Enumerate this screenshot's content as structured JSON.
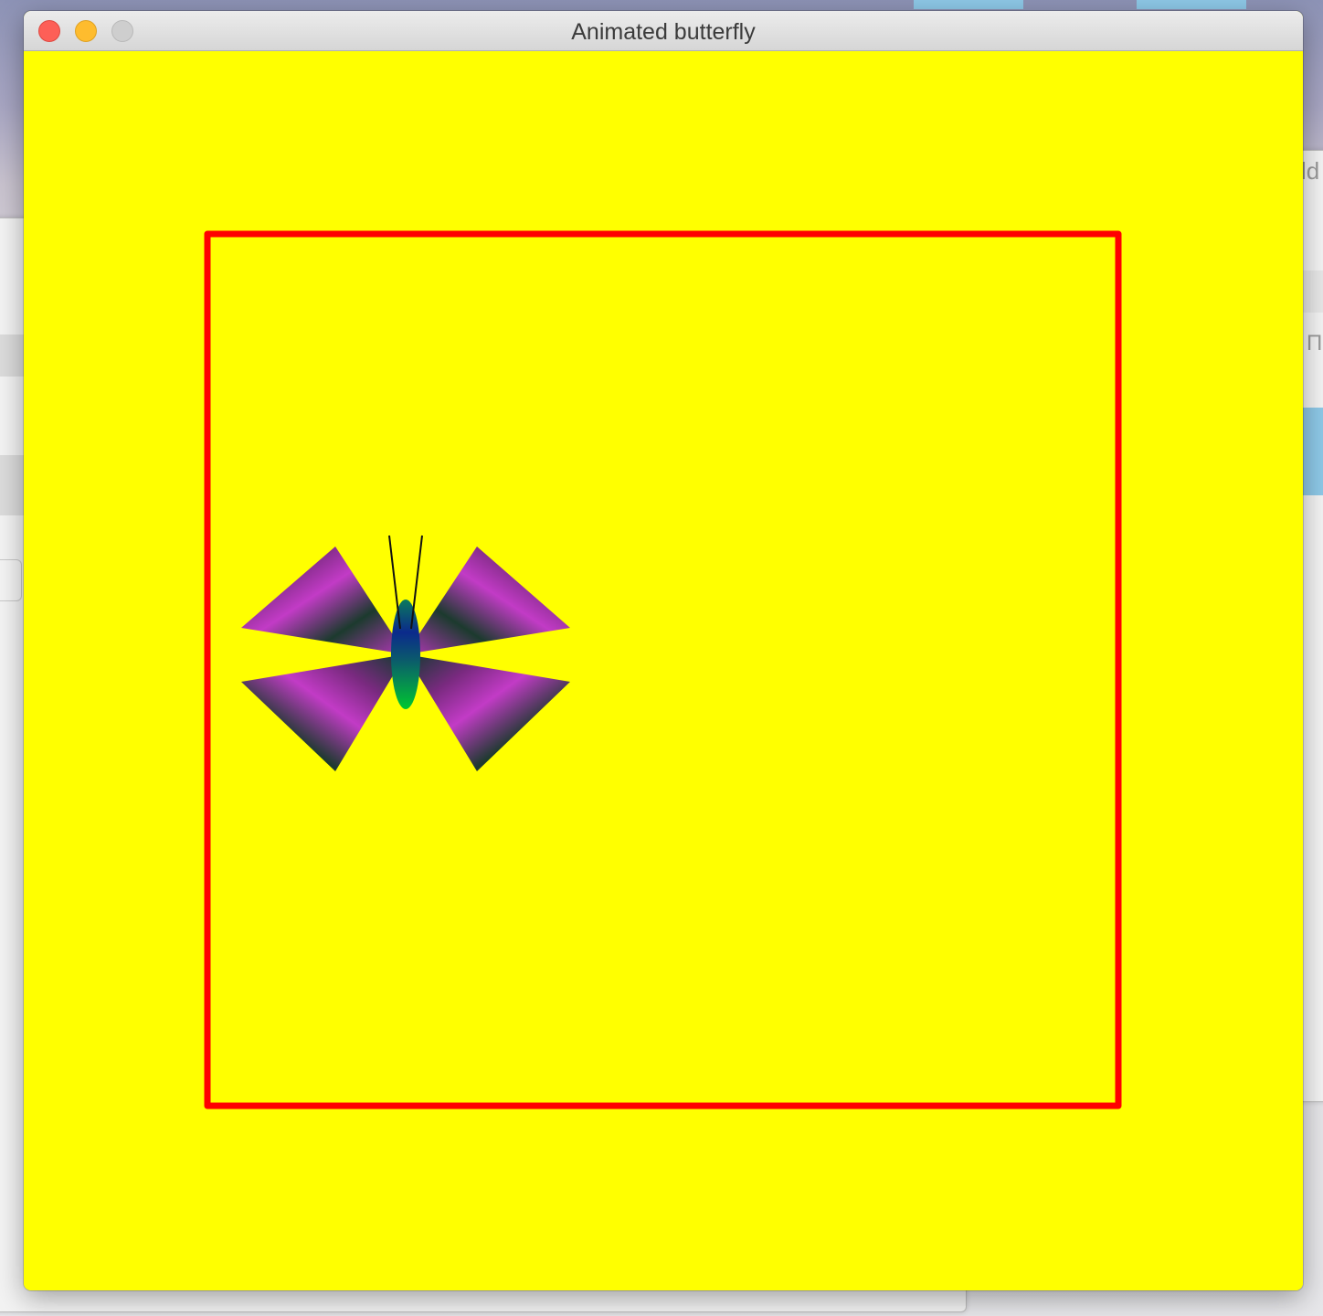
{
  "window": {
    "title": "Animated butterfly"
  },
  "colors": {
    "canvas_background": "#ffff00",
    "frame": "#ff0000",
    "wing_magenta": "#c23bc6",
    "wing_dark": "#0f3b2c",
    "body_blue": "#0b2a8c",
    "body_green": "#00c830",
    "antenna": "#111111"
  },
  "background_windows": {
    "partial_text_right": "ld",
    "partial_glyph_right": "П"
  }
}
